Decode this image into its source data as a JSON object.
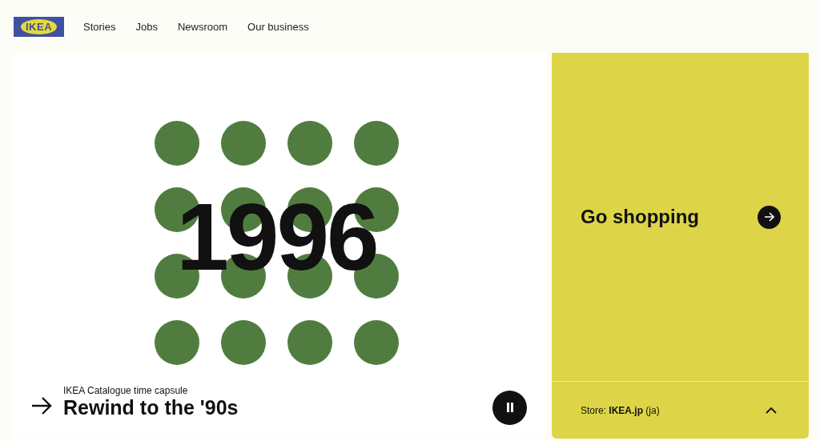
{
  "header": {
    "logo": "IKEA",
    "nav": [
      "Stories",
      "Jobs",
      "Newsroom",
      "Our business"
    ]
  },
  "hero": {
    "year": "1996",
    "eyebrow": "IKEA Catalogue time capsule",
    "title": "Rewind to the '90s"
  },
  "side": {
    "title": "Go shopping",
    "store": "Store: **IKEA.jp** (ja)"
  }
}
